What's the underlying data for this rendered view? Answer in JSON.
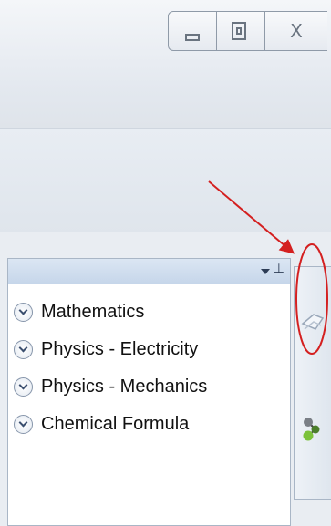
{
  "window_controls": {
    "minimize_icon": "minimize-icon",
    "restore_icon": "restore-icon",
    "close_icon": "close-icon",
    "close_glyph": "X"
  },
  "panel": {
    "header": {
      "menu_icon": "dropdown-triangle-icon",
      "pin_icon": "pin-icon",
      "pin_glyph": "⊥"
    },
    "items": [
      {
        "label": "Mathematics"
      },
      {
        "label": "Physics - Electricity"
      },
      {
        "label": "Physics - Mechanics"
      },
      {
        "label": "Chemical Formula"
      }
    ]
  },
  "side_strip": {
    "tools": [
      {
        "icon": "shape-tool-icon"
      },
      {
        "icon": "molecule-tool-icon"
      }
    ]
  },
  "annotation": {
    "arrow_color": "#d42020",
    "ellipse_color": "#d42020"
  }
}
